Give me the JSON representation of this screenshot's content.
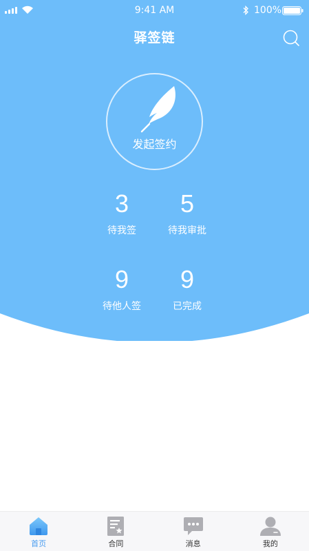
{
  "status_bar": {
    "time": "9:41 AM",
    "battery": "100%"
  },
  "header": {
    "title": "驿签链"
  },
  "sign_button": {
    "label": "发起签约"
  },
  "stats": [
    {
      "value": "3",
      "label": "待我签"
    },
    {
      "value": "5",
      "label": "待我审批"
    },
    {
      "value": "9",
      "label": "待他人签"
    },
    {
      "value": "9",
      "label": "已完成"
    }
  ],
  "tab_bar": {
    "active": "home",
    "items": [
      {
        "id": "home",
        "label": "首页",
        "icon": "home-icon"
      },
      {
        "id": "contract",
        "label": "合同",
        "icon": "document-icon"
      },
      {
        "id": "messages",
        "label": "消息",
        "icon": "chat-icon"
      },
      {
        "id": "profile",
        "label": "我的",
        "icon": "user-icon"
      }
    ]
  },
  "colors": {
    "primary": "#6dbdfa",
    "tab_active": "#4a9df0",
    "tab_inactive": "#aeaeb3"
  }
}
